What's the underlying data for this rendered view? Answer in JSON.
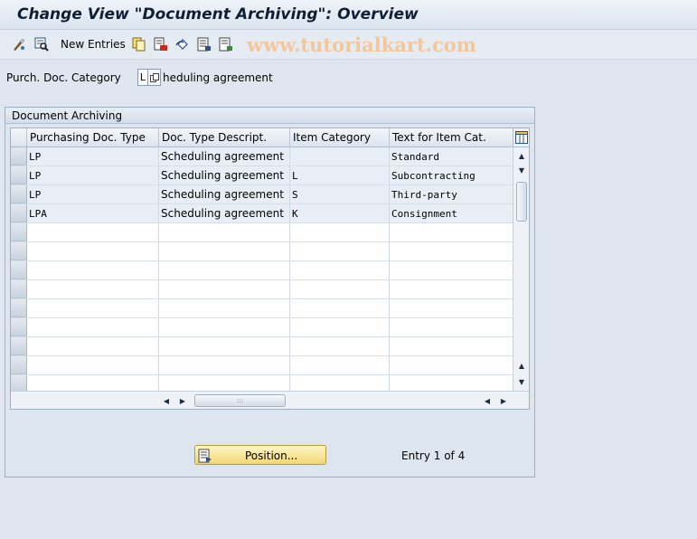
{
  "window": {
    "title": "Change View \"Document Archiving\": Overview"
  },
  "toolbar": {
    "new_entries_label": "New Entries",
    "watermark": "www.tutorialkart.com",
    "icons": [
      "display-change-icon",
      "details-icon",
      "copy-icon",
      "delete-icon",
      "undo-icon",
      "select-all-icon",
      "deselect-all-icon"
    ]
  },
  "filter": {
    "label": "Purch. Doc. Category",
    "value": "L",
    "description": "heduling agreement"
  },
  "group": {
    "title": "Document Archiving"
  },
  "table": {
    "columns": [
      "Purchasing Doc. Type",
      "Doc. Type Descript.",
      "Item Category",
      "Text for Item Cat."
    ],
    "rows": [
      [
        "LP",
        "Scheduling agreement",
        "",
        "Standard"
      ],
      [
        "LP",
        "Scheduling agreement",
        "L",
        "Subcontracting"
      ],
      [
        "LP",
        "Scheduling agreement",
        "S",
        "Third-party"
      ],
      [
        "LPA",
        "Scheduling agreement",
        "K",
        "Consignment"
      ]
    ],
    "empty_rows": 9
  },
  "footer": {
    "position_label": "Position...",
    "entry_text": "Entry 1 of 4"
  },
  "colors": {
    "background": "#dfe6ef",
    "button_yellow": "#f2d774",
    "row_fill": "#e7eef6"
  }
}
